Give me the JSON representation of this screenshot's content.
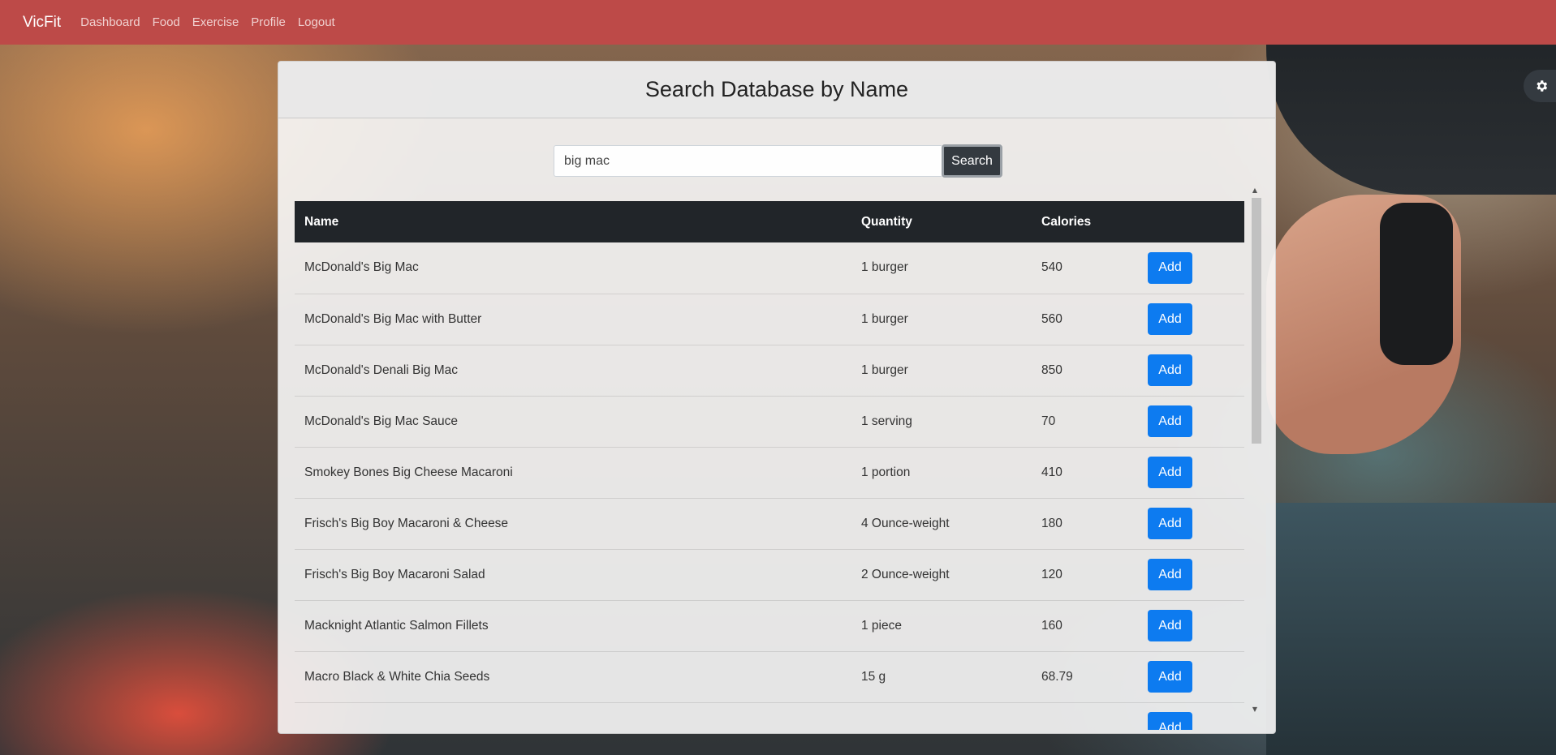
{
  "navbar": {
    "brand": "VicFit",
    "links": [
      "Dashboard",
      "Food",
      "Exercise",
      "Profile",
      "Logout"
    ]
  },
  "card": {
    "title": "Search Database by Name"
  },
  "search": {
    "value": "big mac",
    "button_label": "Search"
  },
  "table": {
    "headers": [
      "Name",
      "Quantity",
      "Calories",
      ""
    ],
    "add_label": "Add",
    "rows": [
      {
        "name": "McDonald's Big Mac",
        "quantity": "1 burger",
        "calories": "540"
      },
      {
        "name": "McDonald's Big Mac with Butter",
        "quantity": "1 burger",
        "calories": "560"
      },
      {
        "name": "McDonald's Denali Big Mac",
        "quantity": "1 burger",
        "calories": "850"
      },
      {
        "name": "McDonald's Big Mac Sauce",
        "quantity": "1 serving",
        "calories": "70"
      },
      {
        "name": "Smokey Bones Big Cheese Macaroni",
        "quantity": "1 portion",
        "calories": "410"
      },
      {
        "name": "Frisch's Big Boy Macaroni & Cheese",
        "quantity": "4 Ounce-weight",
        "calories": "180"
      },
      {
        "name": "Frisch's Big Boy Macaroni Salad",
        "quantity": "2 Ounce-weight",
        "calories": "120"
      },
      {
        "name": "Macknight Atlantic Salmon Fillets",
        "quantity": "1 piece",
        "calories": "160"
      },
      {
        "name": "Macro Black & White Chia Seeds",
        "quantity": "15 g",
        "calories": "68.79"
      },
      {
        "name": "",
        "quantity": "",
        "calories": ""
      }
    ]
  },
  "colors": {
    "navbar": "#bd4a48",
    "table_header": "#212529",
    "add_button": "#0d7bf0",
    "search_button": "#343a40"
  },
  "icons": {
    "settings": "gear-icon",
    "scroll_up": "scroll-up-arrow",
    "scroll_down": "scroll-down-arrow"
  }
}
